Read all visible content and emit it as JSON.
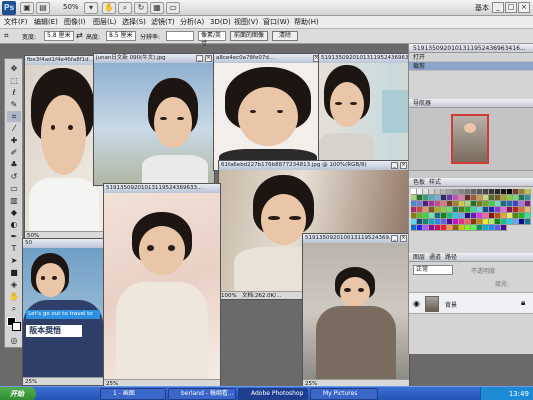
{
  "app": {
    "logo": "Ps",
    "zoom": "50%",
    "workspace": "基本"
  },
  "menu": [
    "文件(F)",
    "编辑(E)",
    "图像(I)",
    "图层(L)",
    "选择(S)",
    "滤镜(T)",
    "分析(A)",
    "3D(D)",
    "视图(V)",
    "窗口(W)",
    "帮助(H)"
  ],
  "options": {
    "width_label": "宽度:",
    "width_value": "5.8 厘米",
    "height_label": "高度:",
    "height_value": "8.5 厘米",
    "res_label": "分辨率:",
    "res_value": "",
    "res_unit": "像素/英寸",
    "front_image": "前面的图像",
    "clear": "清除"
  },
  "documents": [
    {
      "title": "fbe3f4ad1f4e46fa8f1d...",
      "zoom": "50%",
      "status": ""
    },
    {
      "title": "junan日文新 090(牛文).jpg",
      "zoom": "",
      "status": ""
    },
    {
      "title": "a8ce4ec0a78fe07d...",
      "zoom": "",
      "status": ""
    },
    {
      "title": "5191350920101311952436963416...",
      "zoom": "",
      "status": ""
    },
    {
      "title": "61fa6ebd227b176b8877234813.jpg @ 100%(RGB/8)",
      "zoom": "100%",
      "status": "文档:262.0K/..."
    },
    {
      "title": "51913509201013119524369633...",
      "zoom": "25%",
      "status": ""
    },
    {
      "title": "519135092010013119524369...",
      "zoom": "25%",
      "status": ""
    },
    {
      "title": "50",
      "zoom": "25%",
      "status": ""
    },
    {
      "title": "",
      "zoom": "100%",
      "status": ""
    }
  ],
  "poster": {
    "line1": "Let's go out to travel to",
    "line2": "阪本奨悟"
  },
  "rightpanel": {
    "history_title": "5191350920101311952436963416...",
    "history_items": [
      "打开",
      "裁剪"
    ],
    "nav_tab": "导航器",
    "color_tabs": [
      "色板",
      "样式"
    ],
    "layers_tabs": [
      "图层",
      "通道",
      "路径"
    ],
    "blend_mode": "正常",
    "opacity_label": "不透明度:",
    "fill_label": "填充:",
    "layer_name": "背景"
  },
  "taskbar": {
    "start": "开始",
    "tasks": [
      "1 - 画图",
      "berland - 稿纲看...",
      "Adobe Photoshop",
      "My Pictures"
    ],
    "clock": "13:49"
  },
  "colors": {
    "taskbar": "#2453b3",
    "start": "#2f8a2f",
    "appbar": "#d2d2d2"
  }
}
